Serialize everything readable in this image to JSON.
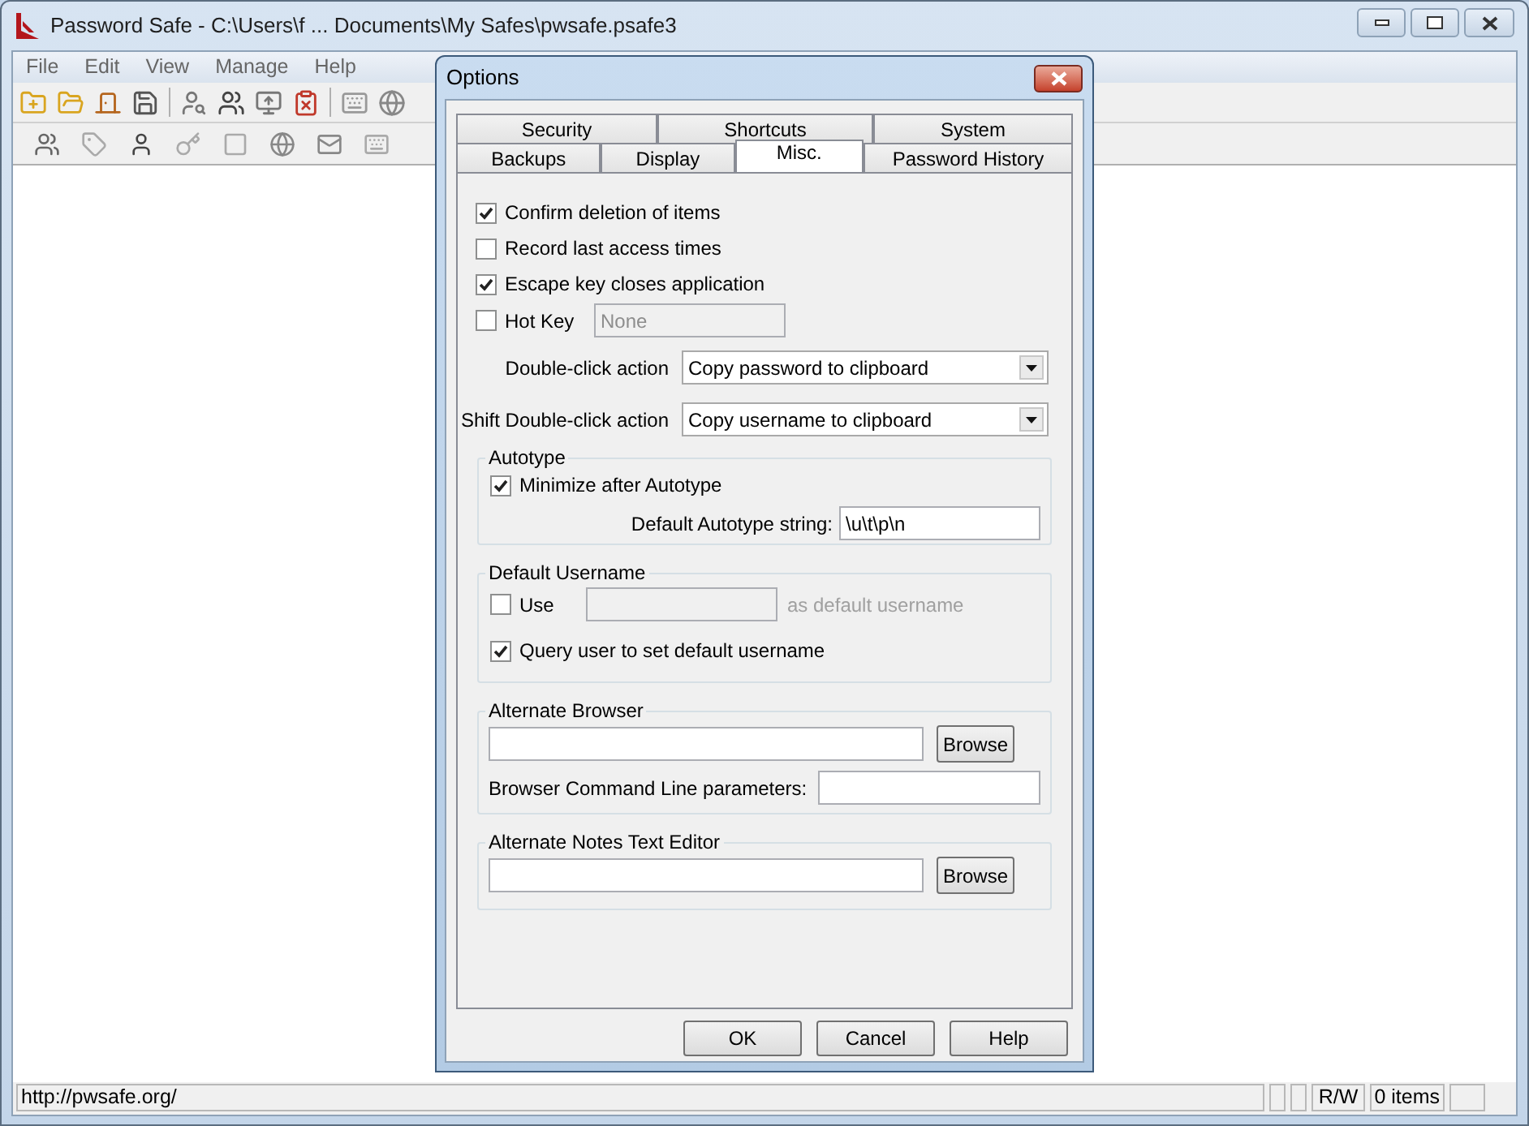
{
  "main_window": {
    "title": "Password Safe - C:\\Users\\f ... Documents\\My Safes\\pwsafe.psafe3",
    "menu": [
      "File",
      "Edit",
      "View",
      "Manage",
      "Help"
    ],
    "status_bar": {
      "url": "http://pwsafe.org/",
      "mode": "R/W",
      "count": "0 items"
    }
  },
  "dialog": {
    "title": "Options",
    "tab_rows": [
      [
        {
          "label": "Security",
          "selected": false
        },
        {
          "label": "Shortcuts",
          "selected": false
        },
        {
          "label": "System",
          "selected": false
        }
      ],
      [
        {
          "label": "Backups",
          "selected": false
        },
        {
          "label": "Display",
          "selected": false
        },
        {
          "label": "Misc.",
          "selected": true
        },
        {
          "label": "Password History",
          "selected": false
        }
      ]
    ],
    "checkboxes": [
      {
        "label": "Confirm deletion of items",
        "checked": true
      },
      {
        "label": "Record last access times",
        "checked": false
      },
      {
        "label": "Escape key closes application",
        "checked": true
      }
    ],
    "hot_key": {
      "label": "Hot Key",
      "checked": false,
      "value": "None",
      "disabled": true
    },
    "actions": [
      {
        "label": "Double-click action",
        "value": "Copy password to clipboard"
      },
      {
        "label": "Shift Double-click action",
        "value": "Copy username to clipboard"
      }
    ],
    "autotype": {
      "title": "Autotype",
      "minimize": {
        "label": "Minimize after Autotype",
        "checked": true
      },
      "string_label": "Default Autotype string:",
      "string_value": "\\u\\t\\p\\n"
    },
    "default_username": {
      "title": "Default Username",
      "use": {
        "label": "Use",
        "checked": false
      },
      "field_disabled": true,
      "suffix": "as default username",
      "query": {
        "label": "Query user to set default username",
        "checked": true
      }
    },
    "alternate_browser": {
      "title": "Alternate Browser",
      "browse": "Browse",
      "params_label": "Browser Command Line parameters:"
    },
    "alternate_editor": {
      "title": "Alternate Notes Text Editor",
      "browse": "Browse"
    },
    "buttons": [
      "OK",
      "Cancel",
      "Help"
    ]
  }
}
